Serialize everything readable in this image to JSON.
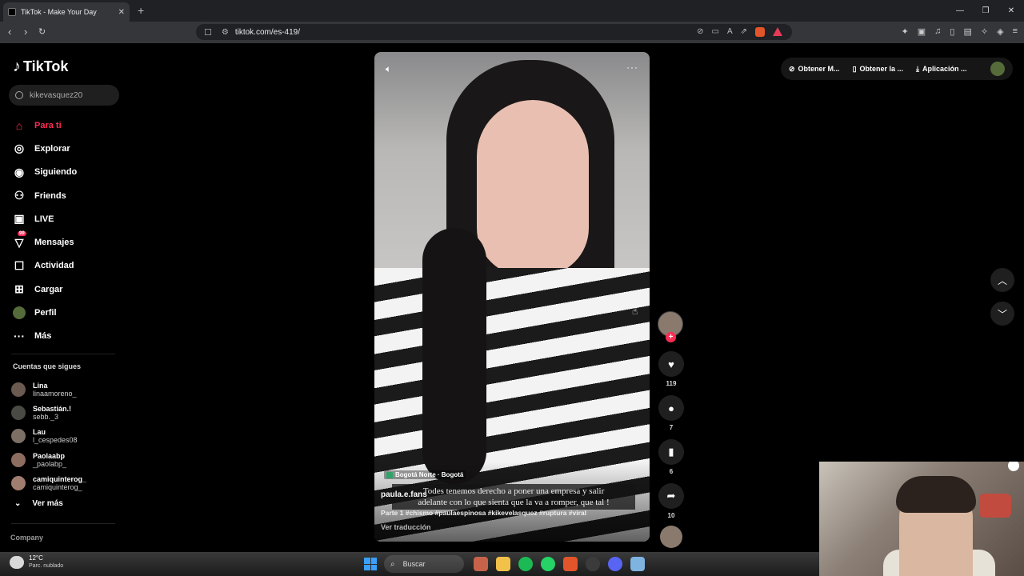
{
  "browser": {
    "tab_title": "TikTok - Make Your Day",
    "tab_close": "✕",
    "new_tab": "+",
    "url": "tiktok.com/es-419/",
    "win_min": "—",
    "win_max": "❐",
    "win_close": "✕"
  },
  "sidebar": {
    "logo": "TikTok",
    "search_value": "kikevasquez20",
    "nav": [
      {
        "label": "Para ti",
        "icon": "home-icon",
        "active": true
      },
      {
        "label": "Explorar",
        "icon": "compass-icon"
      },
      {
        "label": "Siguiendo",
        "icon": "following-icon"
      },
      {
        "label": "Friends",
        "icon": "friends-icon"
      },
      {
        "label": "LIVE",
        "icon": "live-icon"
      },
      {
        "label": "Mensajes",
        "icon": "messages-icon",
        "badge": "99"
      },
      {
        "label": "Actividad",
        "icon": "activity-icon"
      },
      {
        "label": "Cargar",
        "icon": "upload-icon"
      },
      {
        "label": "Perfil",
        "icon": "profile-icon"
      },
      {
        "label": "Más",
        "icon": "more-icon"
      }
    ],
    "following_title": "Cuentas que sigues",
    "following": [
      {
        "name": "Lina",
        "handle": "linaamoreno_"
      },
      {
        "name": "Sebastián.!",
        "handle": "sebb._3"
      },
      {
        "name": "Lau",
        "handle": "l_cespedes08"
      },
      {
        "name": "Paolaabp",
        "handle": "_paolabp_"
      },
      {
        "name": "camiquinterog_",
        "handle": "camiquinterog_"
      }
    ],
    "see_more": "Ver más",
    "company": "Company"
  },
  "video": {
    "location": "Bogotá Norte · Bogotá",
    "subtitle_line1": "Todes tenemos derecho a poner una empresa y salir",
    "subtitle_line2": "adelante con lo que sienta que la va a romper, que tal !",
    "author": "paula.e.fans",
    "caption": "Parte 1 #chismo #paulaespinosa #kikevelasquez #ruptura #viral",
    "translate": "Ver traducción",
    "more": "···"
  },
  "actions": {
    "likes": "119",
    "comments": "7",
    "saves": "6",
    "shares": "10"
  },
  "top_buttons": {
    "btn1": "Obtener M...",
    "btn2": "Obtener la ...",
    "btn3": "Aplicación ..."
  },
  "taskbar": {
    "temp": "12°C",
    "weather": "Parc. nublado",
    "search": "Buscar"
  },
  "colors": {
    "accent": "#fe2c55",
    "background": "#000000"
  }
}
